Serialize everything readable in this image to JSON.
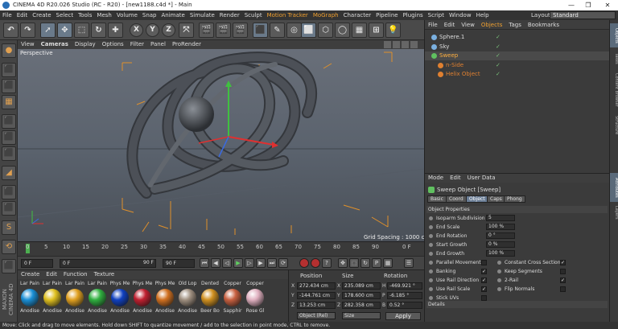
{
  "window": {
    "title": "CINEMA 4D R20.026 Studio (RC - R20) - [new1188.c4d *] - Main",
    "controls": [
      "—",
      "❐",
      "✕"
    ]
  },
  "menubar": {
    "items": [
      "File",
      "Edit",
      "Create",
      "Select",
      "Tools",
      "Mesh",
      "Volume",
      "Snap",
      "Animate",
      "Simulate",
      "Render",
      "Sculpt",
      "Motion Tracker",
      "MoGraph",
      "Character",
      "Pipeline",
      "Plugins",
      "Script",
      "Window",
      "Help"
    ],
    "layout_label": "Layout:",
    "layout_value": "Standard"
  },
  "toolbar": {
    "buttons": [
      "↶",
      "↷",
      "➚",
      "✥",
      "⬚",
      "↻",
      "✚",
      "X",
      "Y",
      "Z",
      "⤧",
      "🎬",
      "🎬",
      "🎬",
      "⬛",
      "✎",
      "◎",
      "⬜",
      "⬡",
      "◯",
      "▦",
      "⊞",
      "💡"
    ]
  },
  "left_tools": [
    "●",
    "⬛",
    "⬛",
    "▦",
    "⬛",
    "⬛",
    "⬛",
    "◢",
    "⬛",
    "⬛",
    "S",
    "⟲",
    "⬛"
  ],
  "viewport": {
    "menu": [
      "View",
      "Cameras",
      "Display",
      "Options",
      "Filter",
      "Panel",
      "ProRender"
    ],
    "label": "Perspective",
    "grid_spacing": "Grid Spacing : 1000 cm"
  },
  "timeline": {
    "ticks": [
      "0",
      "5",
      "10",
      "15",
      "20",
      "25",
      "30",
      "35",
      "40",
      "45",
      "50",
      "55",
      "60",
      "65",
      "70",
      "75",
      "80",
      "85",
      "90"
    ],
    "end_label": "0 F"
  },
  "playbar": {
    "start_frame": "0 F",
    "current_frame": "0 F",
    "end_frame": "90 F",
    "max_frame": "90 F"
  },
  "materials": {
    "menu": [
      "Create",
      "Edit",
      "Function",
      "Texture"
    ],
    "row1_labels": [
      "Lar Pain",
      "Lar Pain",
      "Lar Pain",
      "Lar Pain",
      "Phys Me",
      "Phys Me",
      "Phys Me",
      "Old Lop",
      "Dented",
      "Copper",
      "Copper"
    ],
    "row2_labels": [
      "Anodise",
      "Anodise",
      "Anodise",
      "Anodise",
      "Anodise",
      "Anodise",
      "Anodise",
      "Anodise",
      "Beer Bo",
      "Sapphir",
      "Rose Gl"
    ],
    "colors": [
      "#1a8fd6",
      "#e0c020",
      "#e0a020",
      "#30b040",
      "#1040c0",
      "#c02030",
      "#d07020",
      "#a09080",
      "#d09020",
      "#c86040",
      "#e0b0c0"
    ]
  },
  "coordinates": {
    "headers": [
      "Position",
      "Size",
      "Rotation"
    ],
    "pos": {
      "x": "272.434 cm",
      "y": "-144.761 cm",
      "z": "13.253 cm"
    },
    "size": {
      "x": "235.089 cm",
      "y": "178.600 cm",
      "z": "282.358 cm"
    },
    "rot": {
      "h": "-469.921 °",
      "p": "-6.185 °",
      "b": "0.52 °"
    },
    "axis_labels": {
      "x": "X",
      "y": "Y",
      "z": "Z",
      "sx": "X",
      "sy": "Y",
      "sz": "Z",
      "h": "H",
      "p": "P",
      "b": "B"
    },
    "mode": "Object (Rel)",
    "size_mode": "Size",
    "apply": "Apply"
  },
  "objects": {
    "menu": [
      "File",
      "Edit",
      "View",
      "Objects",
      "Tags",
      "Bookmarks"
    ],
    "active_tab": "Objects",
    "items": [
      {
        "name": "Sphere.1",
        "color": "#7ab0e0",
        "indent": 0
      },
      {
        "name": "Sky",
        "color": "#7ab0e0",
        "indent": 0
      },
      {
        "name": "Sweep",
        "color": "#60c060",
        "indent": 0
      },
      {
        "name": "n-Side",
        "color": "#e08030",
        "indent": 1
      },
      {
        "name": "Helix Object",
        "color": "#e08030",
        "indent": 1
      }
    ]
  },
  "attributes": {
    "menu": [
      "Mode",
      "Edit",
      "User Data"
    ],
    "title": "Sweep Object [Sweep]",
    "tabs": [
      "Basic",
      "Coord",
      "Object",
      "Caps",
      "Phong"
    ],
    "active_tab": "Object",
    "section": "Object Properties",
    "isoparm_label": "Isoparm Subdivision",
    "isoparm_value": "5",
    "end_scale_label": "End Scale",
    "end_scale_value": "100 %",
    "end_rotation_label": "End Rotation",
    "end_rotation_value": "0 °",
    "start_growth_label": "Start Growth",
    "start_growth_value": "0 %",
    "end_growth_label": "End Growth",
    "end_growth_value": "100 %",
    "parallel_movement": "Parallel Movement",
    "constant_cross_section": "Constant Cross Section",
    "banking": "Banking",
    "keep_segments": "Keep Segments",
    "use_rail_direction": "Use Rail Direction",
    "two_rail": "2-Rail",
    "use_rail_scale": "Use Rail Scale",
    "flip_normals": "Flip Normals",
    "stick_uvs": "Stick UVs",
    "details": "Details",
    "check": "✓"
  },
  "right_tabs": [
    "Objects",
    "Takes",
    "Content Browser",
    "Structure",
    "Attributes",
    "Layers"
  ],
  "statusbar": "Move: Click and drag to move elements. Hold down SHIFT to quantize movement / add to the selection in point mode, CTRL to remove."
}
